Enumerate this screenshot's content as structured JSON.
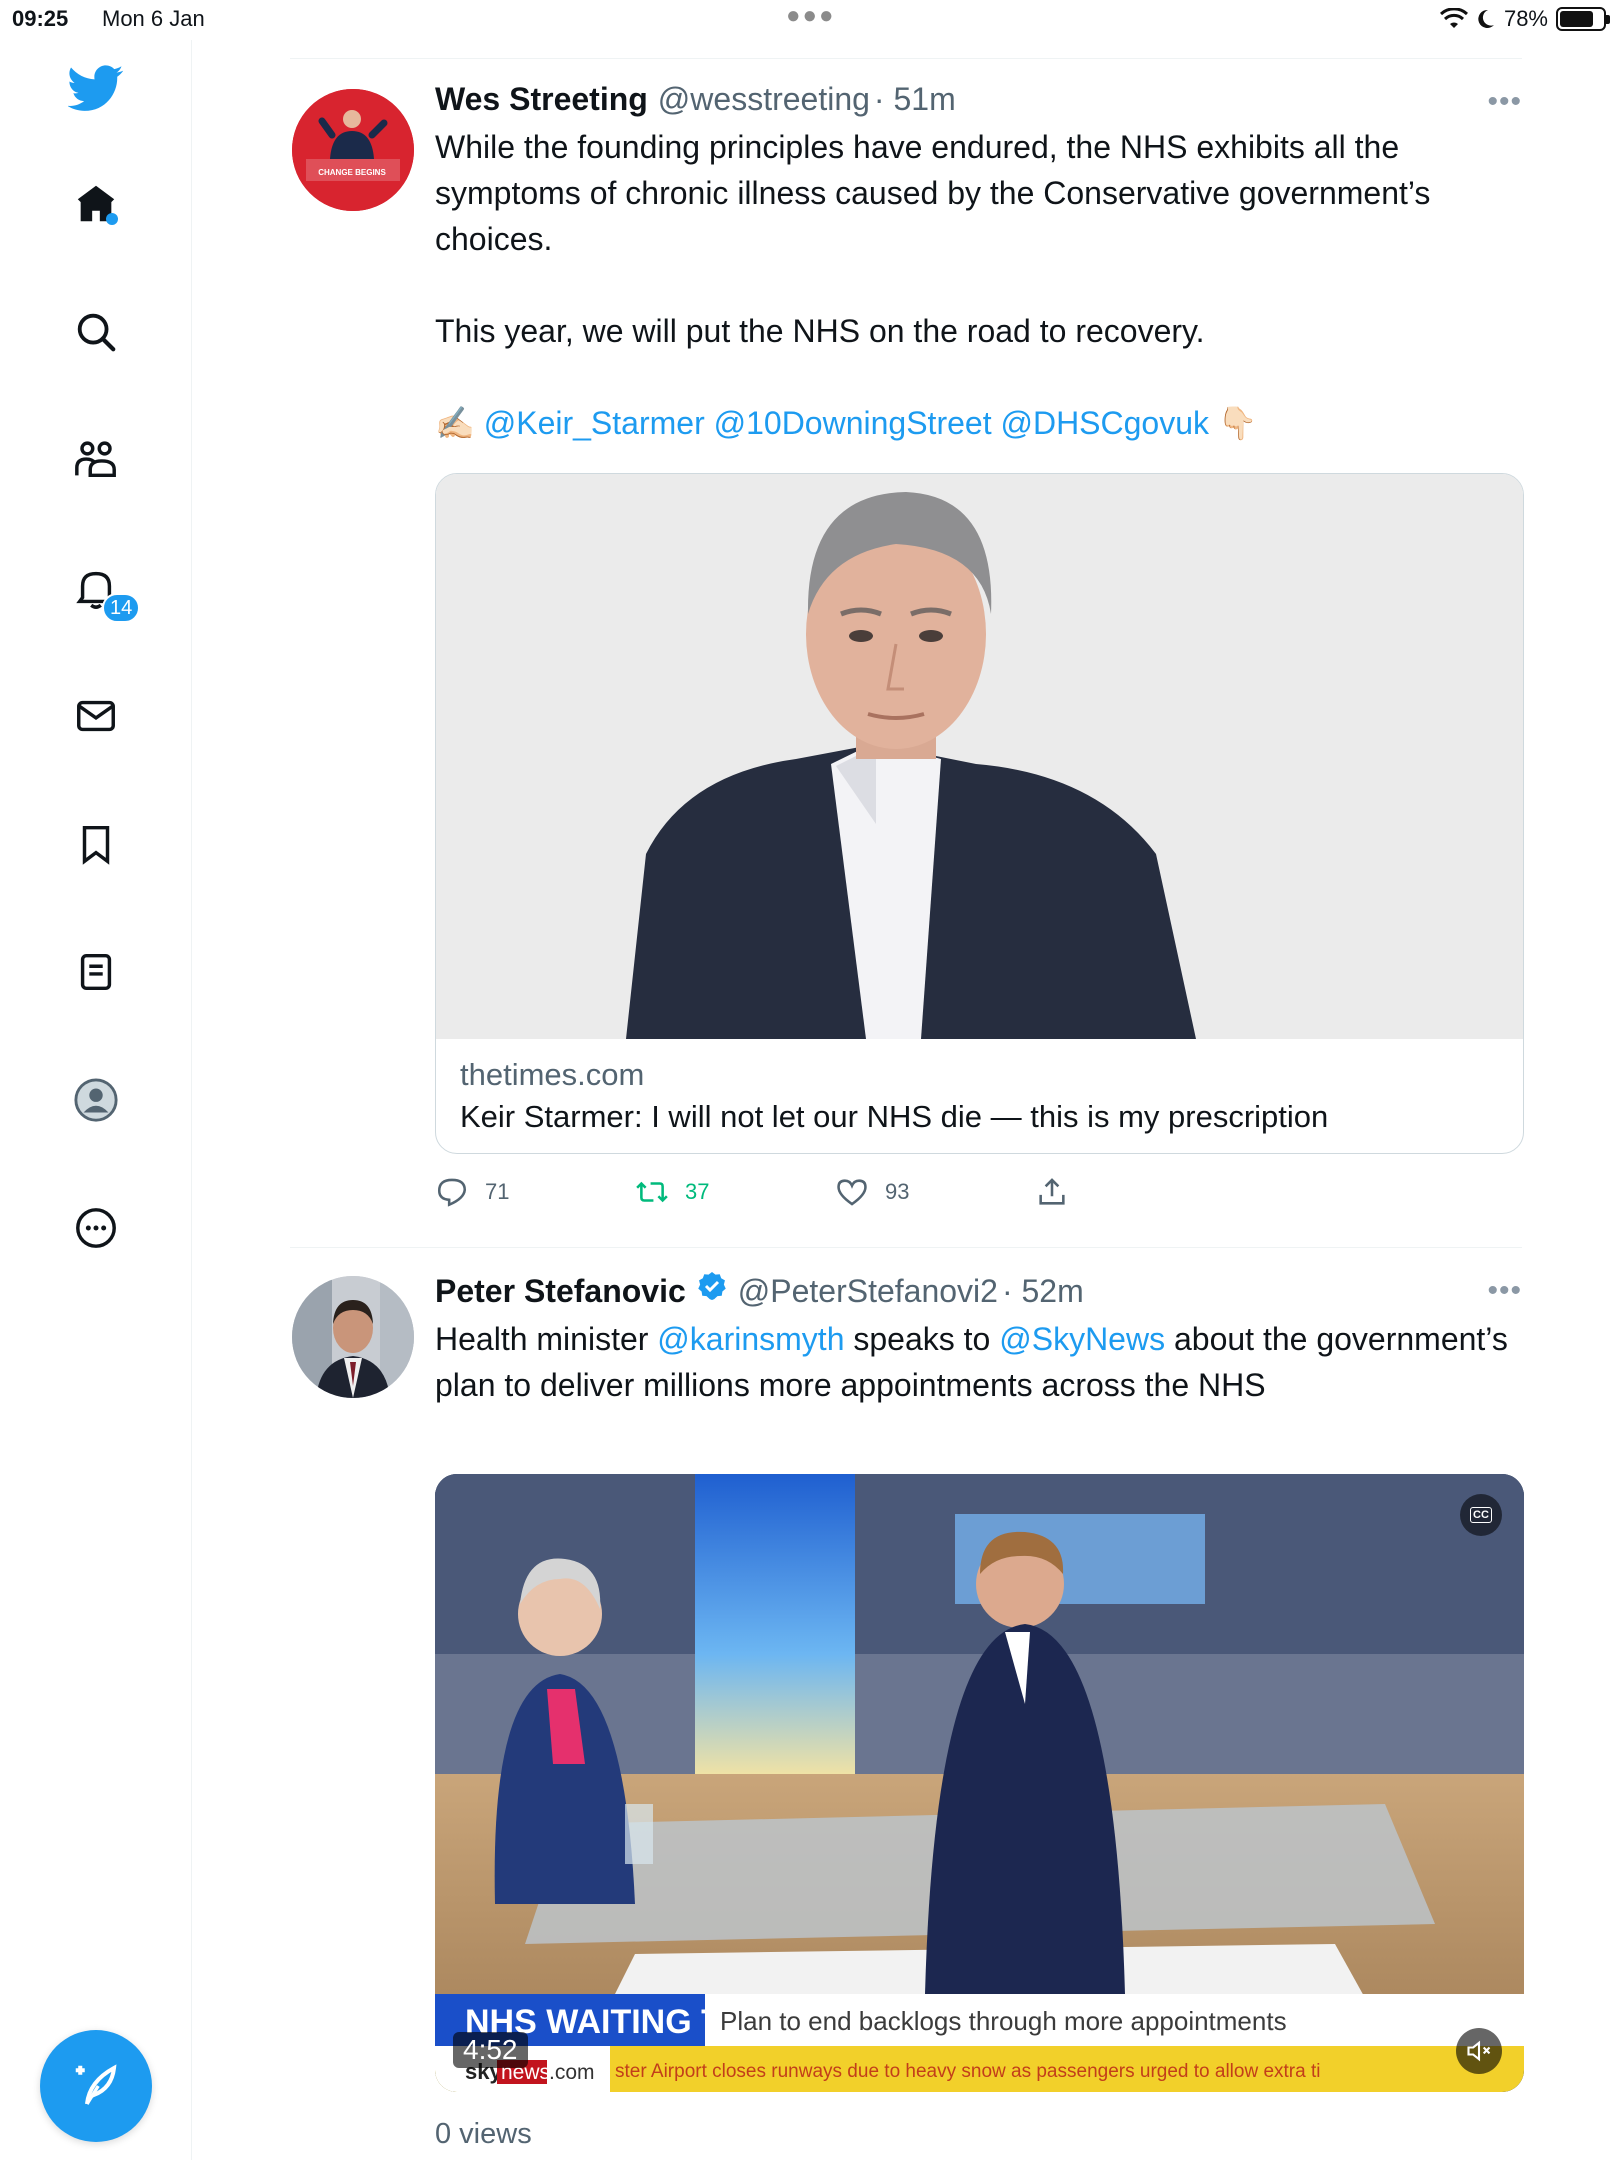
{
  "status_bar": {
    "time": "09:25",
    "date": "Mon 6 Jan",
    "battery": "78%",
    "battery_level": 0.78
  },
  "sidebar": {
    "notifications_badge": "14",
    "items": [
      "twitter-logo",
      "home-icon",
      "search-icon",
      "communities-icon",
      "notifications-icon",
      "messages-icon",
      "bookmarks-icon",
      "lists-icon",
      "profile-icon",
      "more-icon"
    ]
  },
  "tweets": [
    {
      "name": "Wes Streeting",
      "handle": "@wesstreeting",
      "time": "· 51m",
      "text_p1": "While the founding principles have endured, the NHS exhibits all the symptoms of chronic illness caused by the Conservative government’s choices.",
      "text_p2": "This year, we will put the NHS on the road to recovery.",
      "emoji_start": "✍🏻",
      "mentions": [
        "@Keir_Starmer",
        "@10DowningStreet",
        "@DHSCgovuk"
      ],
      "emoji_end": "👇🏻",
      "avatar_caption": "CHANGE BEGINS",
      "card": {
        "domain": "thetimes.com",
        "title": "Keir Starmer: I will not let our NHS die — this is my prescription"
      },
      "replies": "71",
      "retweets": "37",
      "likes": "93"
    },
    {
      "name": "Peter Stefanovic",
      "handle": "@PeterStefanovi2",
      "time": "· 52m",
      "text_before": "Health minister ",
      "mention1": "@karinsmyth",
      "text_mid": " speaks to ",
      "mention2": "@SkyNews",
      "text_after": " about the government’s plan to deliver millions more appointments across the NHS",
      "video": {
        "headline": "NHS WAITING TIMES",
        "subhead": "Plan to end backlogs through more appointments",
        "ticker": "ster Airport closes runways due to heavy snow as passengers urged to allow extra ti",
        "duration": "4:52",
        "brand_a": "sky",
        "brand_b": "news",
        "brand_c": ".com",
        "cc": "CC"
      },
      "views": "0 views"
    }
  ],
  "colors": {
    "accent": "#1d9bf0",
    "retweet": "#00ba7c",
    "secondary_text": "#536471"
  }
}
